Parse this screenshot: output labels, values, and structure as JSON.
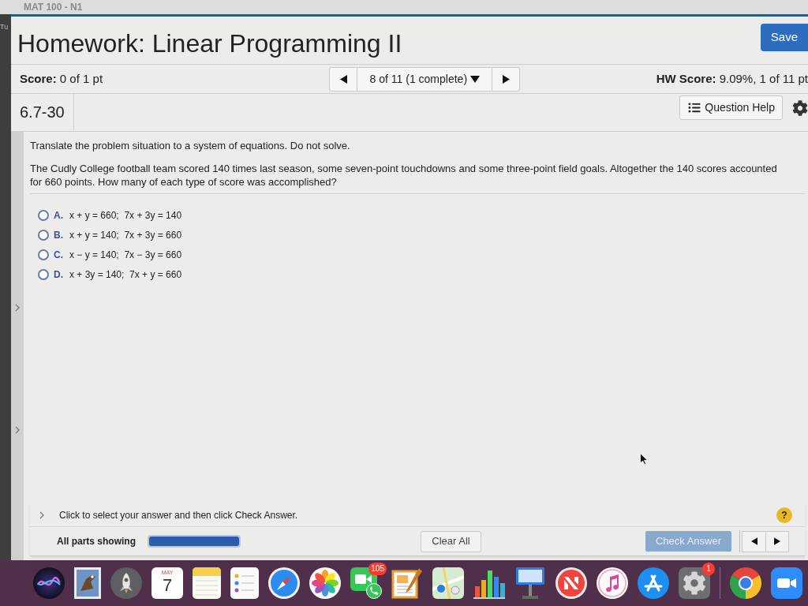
{
  "browser": {
    "tab_title": "MAT 100 - N1",
    "side_label": "Tu"
  },
  "header": {
    "title": "Homework: Linear Programming II",
    "save_button": "Save"
  },
  "score_bar": {
    "score": "**Score:** 0 of 1 pt",
    "question_selector": "8 of 11 (1 complete)",
    "hw_score": "**HW Score:** 9.09%, 1 of 11 pt"
  },
  "question": {
    "id": "6.7-30",
    "help_button": "Question Help",
    "instruction": "Translate the problem situation to a system of equations. Do not solve.",
    "problem": "The Cudly College football team scored 140 times last season, some seven-point touchdowns and some three-point field goals. Altogether the 140 scores accounted for 660 points. How many of each type of score was accomplished?",
    "options": [
      {
        "letter": "A.",
        "text": "x + y = 660;  7x + 3y = 140",
        "selected": false
      },
      {
        "letter": "B.",
        "text": "x + y = 140;  7x + 3y = 660",
        "selected": false
      },
      {
        "letter": "C.",
        "text": "x − y = 140;  7x − 3y = 660",
        "selected": false
      },
      {
        "letter": "D.",
        "text": "x + 3y = 140;  7x + y = 660",
        "selected": false
      }
    ]
  },
  "footer": {
    "hint": "Click to select your answer and then click Check Answer.",
    "help_button": "?",
    "parts_label": "All parts showing",
    "parts_progress": {
      "level": 1
    },
    "clear_button": "Clear All",
    "check_button": {
      "label": "Check Answer",
      "disabled": true
    }
  },
  "dock": {
    "items": [
      {
        "kind": "orb"
      },
      {
        "kind": "stamp"
      },
      {
        "kind": "rocket"
      },
      {
        "kind": "calendar",
        "month": "MAY",
        "day": "7"
      },
      {
        "kind": "notepad"
      },
      {
        "kind": "checklist"
      },
      {
        "kind": "compass"
      },
      {
        "kind": "flower"
      },
      {
        "kind": "videocall",
        "badge": "105"
      },
      {
        "kind": "document"
      },
      {
        "kind": "map"
      },
      {
        "kind": "chart"
      },
      {
        "kind": "podium"
      },
      {
        "kind": "stripes"
      },
      {
        "kind": "music"
      },
      {
        "kind": "triangle"
      },
      {
        "kind": "gear",
        "badge": "1"
      },
      {
        "kind": "divider"
      },
      {
        "kind": "wheel"
      },
      {
        "kind": "camera"
      }
    ]
  }
}
